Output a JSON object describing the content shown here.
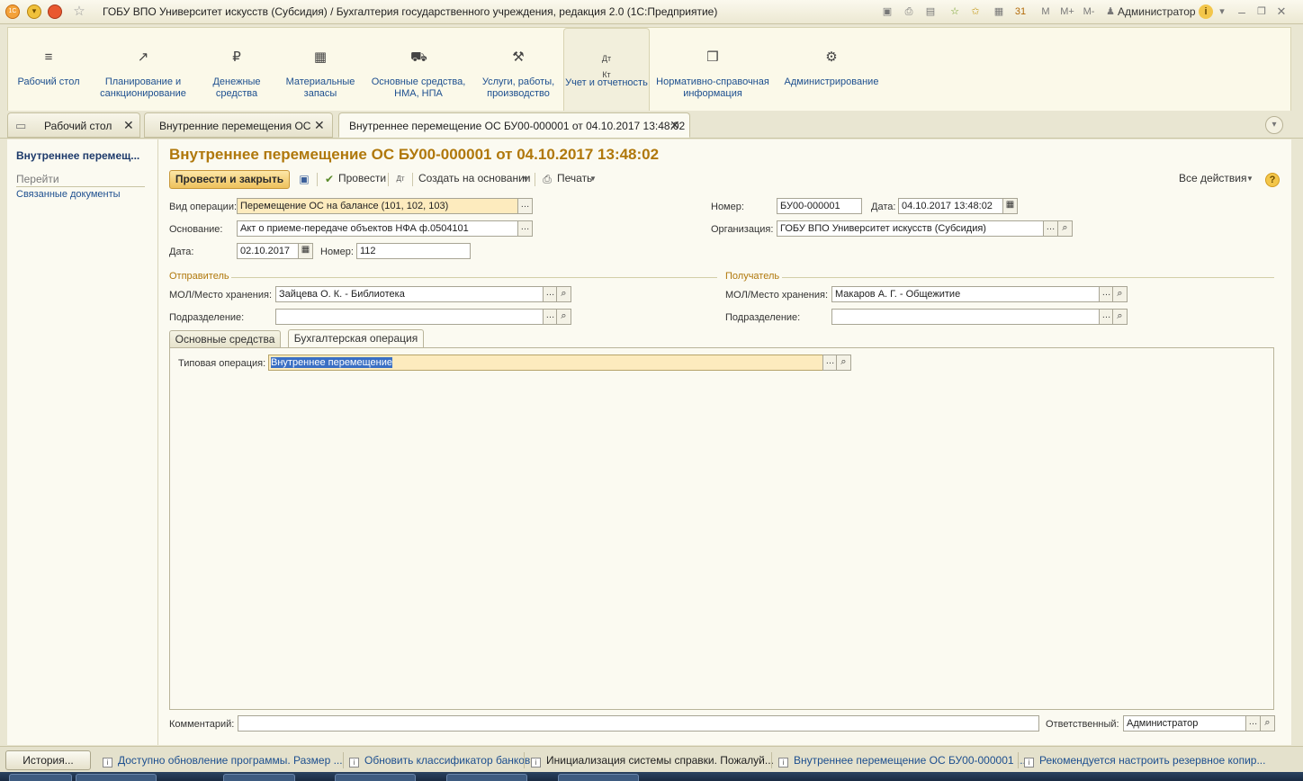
{
  "window": {
    "title": "ГОБУ ВПО Университет искусств (Субсидия) / Бухгалтерия государственного учреждения, редакция 2.0  (1С:Предприятие)",
    "user": "Администратор",
    "memory_buttons": [
      "M",
      "M+",
      "M-"
    ]
  },
  "sections": [
    {
      "label": "Рабочий стол",
      "icon": "menu-lines-icon"
    },
    {
      "label": "Планирование и санкционирование",
      "icon": "planning-icon"
    },
    {
      "label": "Денежные средства",
      "icon": "ruble-coin-icon"
    },
    {
      "label": "Материальные запасы",
      "icon": "grid-icon"
    },
    {
      "label": "Основные средства, НМА, НПА",
      "icon": "truck-icon"
    },
    {
      "label": "Услуги, работы, производство",
      "icon": "tools-icon"
    },
    {
      "label": "Учет и отчетность",
      "icon": "debit-credit-icon",
      "active": true
    },
    {
      "label": "Нормативно-справочная информация",
      "icon": "books-icon"
    },
    {
      "label": "Администрирование",
      "icon": "gear-icon"
    }
  ],
  "tabs": [
    {
      "label": "Рабочий стол"
    },
    {
      "label": "Внутренние перемещения ОС"
    },
    {
      "label": "Внутреннее перемещение ОС БУ00-000001 от 04.10.2017 13:48:02",
      "active": true
    }
  ],
  "nav": {
    "current": "Внутреннее перемещ...",
    "goto_header": "Перейти",
    "related": "Связанные документы"
  },
  "document": {
    "title": "Внутреннее перемещение ОС БУ00-000001 от 04.10.2017 13:48:02",
    "toolbar": {
      "post_close": "Провести и закрыть",
      "post": "Провести",
      "create_based": "Создать на основании",
      "print": "Печать",
      "all_actions": "Все действия",
      "help": "?"
    },
    "operation_type": {
      "label": "Вид операции:",
      "value": "Перемещение ОС на балансе (101, 102, 103)"
    },
    "basis": {
      "label": "Основание:",
      "value": "Акт о приеме-передаче объектов НФА ф.0504101"
    },
    "basis_date": {
      "label": "Дата:",
      "value": "02.10.2017"
    },
    "basis_number": {
      "label": "Номер:",
      "value": "112"
    },
    "number": {
      "label": "Номер:",
      "value": "БУ00-000001"
    },
    "date": {
      "label": "Дата:",
      "value": "04.10.2017 13:48:02"
    },
    "organization": {
      "label": "Организация:",
      "value": "ГОБУ ВПО Университет искусств (Субсидия)"
    },
    "sender": {
      "header": "Отправитель",
      "mol_label": "МОЛ/Место хранения:",
      "mol_value": "Зайцева О. К. - Библиотека",
      "dept_label": "Подразделение:",
      "dept_value": ""
    },
    "receiver": {
      "header": "Получатель",
      "mol_label": "МОЛ/Место хранения:",
      "mol_value": "Макаров А. Г. - Общежитие",
      "dept_label": "Подразделение:",
      "dept_value": ""
    },
    "inner_tabs": [
      {
        "label": "Основные средства"
      },
      {
        "label": "Бухгалтерская операция",
        "active": true
      }
    ],
    "typical_operation": {
      "label": "Типовая операция:",
      "value": "Внутреннее перемещение"
    },
    "comment": {
      "label": "Комментарий:",
      "value": ""
    },
    "responsible": {
      "label": "Ответственный:",
      "value": "Администратор"
    }
  },
  "statusbar": {
    "history": "История...",
    "messages": [
      "Доступно обновление программы. Размер ...",
      "Обновить классификатор банков",
      "Инициализация системы справки. Пожалуй...",
      "Внутреннее перемещение ОС БУ00-000001 ...",
      "Рекомендуется настроить резервное копир..."
    ]
  },
  "colors": {
    "accent_title": "#b0780c",
    "link": "#1d4f8f",
    "highlight_field": "#fdebbe",
    "primary_button": "#eec15c"
  }
}
